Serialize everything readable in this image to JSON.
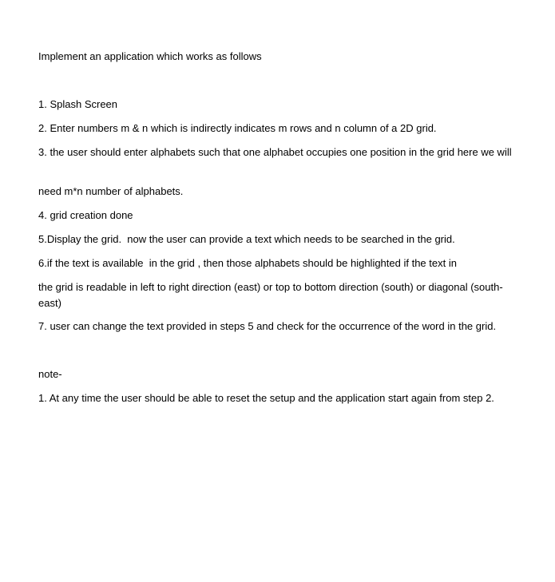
{
  "document": {
    "intro": "Implement an application which works as follows",
    "steps": [
      "1. Splash Screen",
      "2. Enter numbers m & n which is indirectly indicates m rows and n column of a 2D grid.",
      "3. the user should enter alphabets such that one alphabet occupies one position in the grid here we will",
      "need m*n number of alphabets.",
      "4. grid creation done",
      "5.Display the grid.  now the user can provide a text which needs to be searched in the grid.",
      "6.if the text is available  in the grid , then those alphabets should be highlighted if the text in",
      "the grid is readable in left to right direction (east) or top to bottom direction (south) or diagonal (south-east)",
      "7. user can change the text provided in steps 5 and check for the occurrence of the word in the grid."
    ],
    "note_heading": "note-",
    "note_items": [
      "1. At any time the user should be able to reset the setup and the application start again from step 2."
    ]
  }
}
